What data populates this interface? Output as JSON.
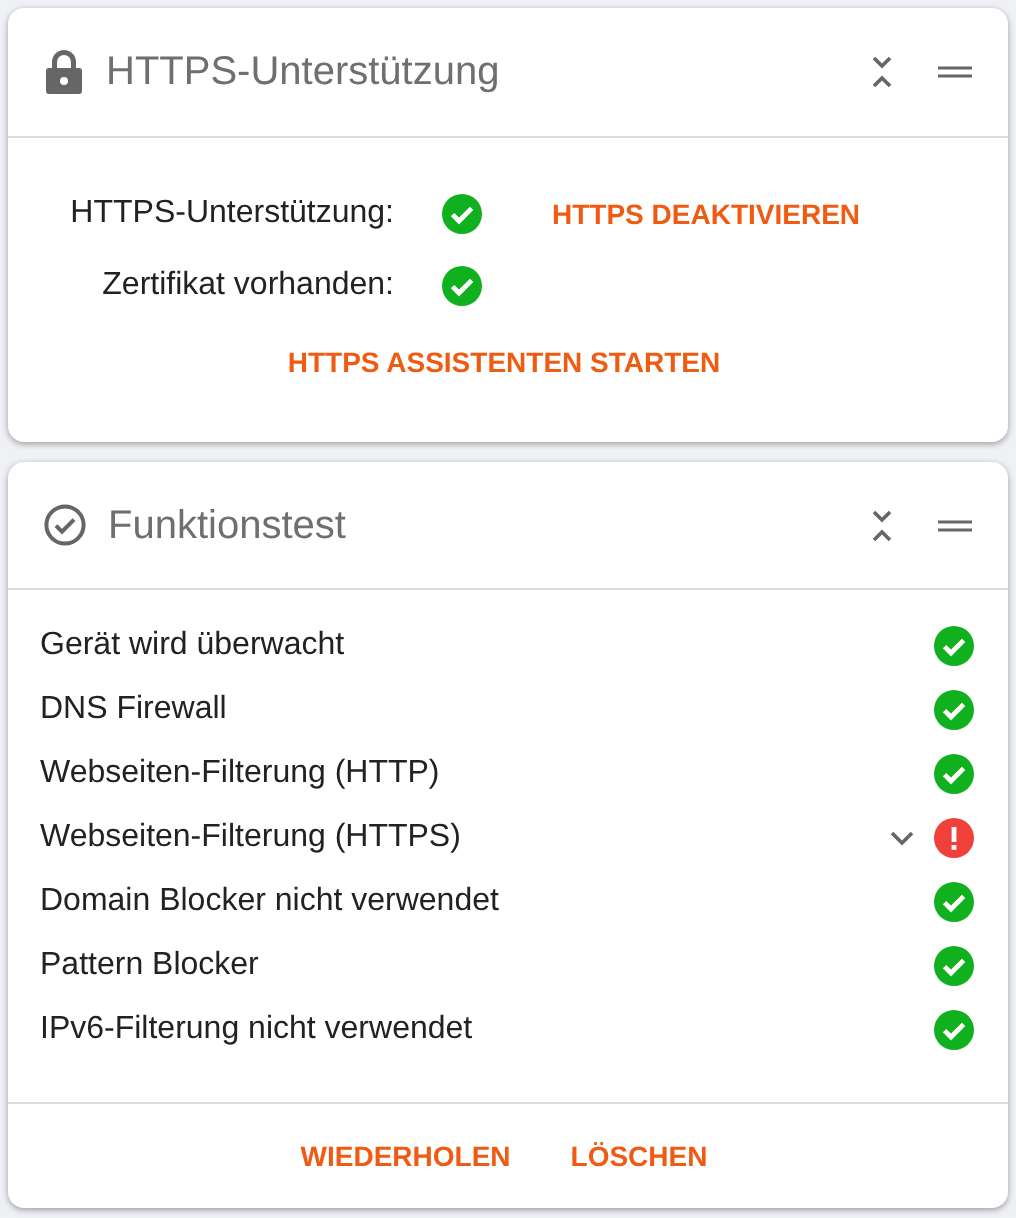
{
  "https_card": {
    "title": "HTTPS-Unterstützung",
    "rows": [
      {
        "label": "HTTPS-Unterstützung:",
        "ok": true,
        "action": "HTTPS DEAKTIVIEREN"
      },
      {
        "label": "Zertifikat vorhanden:",
        "ok": true
      }
    ],
    "button": "HTTPS ASSISTENTEN STARTEN"
  },
  "test_card": {
    "title": "Funktionstest",
    "items": [
      {
        "label": "Gerät wird überwacht",
        "ok": true,
        "expandable": false
      },
      {
        "label": "DNS Firewall",
        "ok": true,
        "expandable": false
      },
      {
        "label": "Webseiten-Filterung (HTTP)",
        "ok": true,
        "expandable": false
      },
      {
        "label": "Webseiten-Filterung (HTTPS)",
        "ok": false,
        "expandable": true
      },
      {
        "label": "Domain Blocker nicht verwendet",
        "ok": true,
        "expandable": false
      },
      {
        "label": "Pattern Blocker",
        "ok": true,
        "expandable": false
      },
      {
        "label": "IPv6-Filterung nicht verwendet",
        "ok": true,
        "expandable": false
      }
    ],
    "buttons": [
      "WIEDERHOLEN",
      "LÖSCHEN"
    ]
  }
}
